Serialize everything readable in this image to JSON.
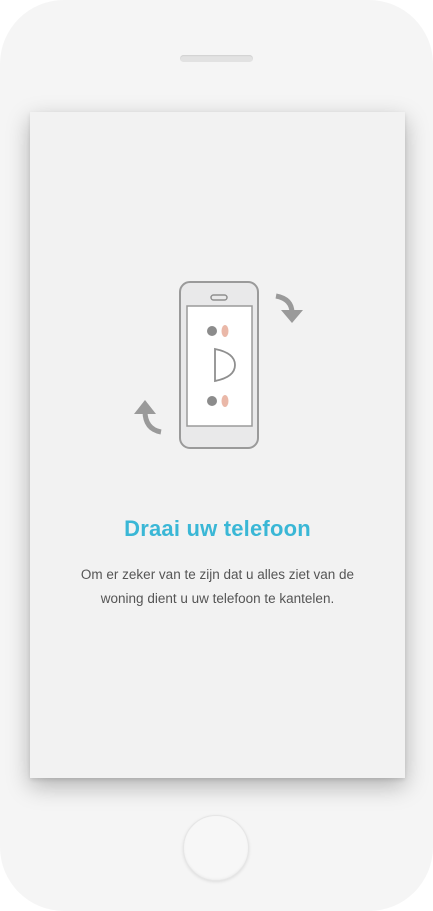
{
  "rotate_prompt": {
    "title": "Draai uw telefoon",
    "message": "Om er zeker van te zijn dat u alles ziet van de woning dient u uw telefoon te kantelen.",
    "title_color": "#3ab7d6",
    "illustration_icon": "rotate-phone-icon"
  },
  "device": {
    "home_button_icon": "home-button",
    "speaker_icon": "speaker-grille"
  }
}
